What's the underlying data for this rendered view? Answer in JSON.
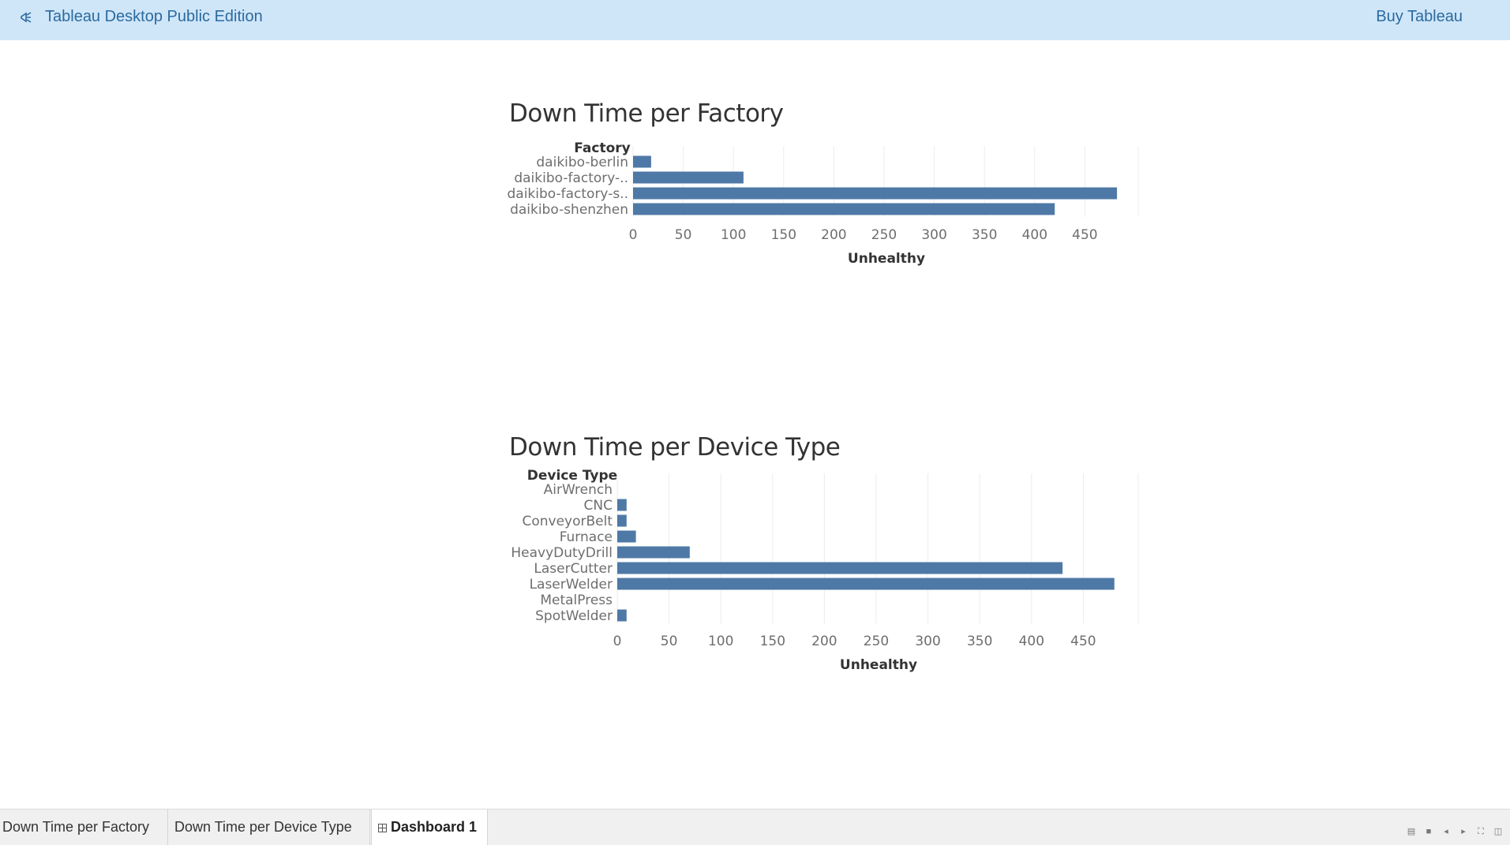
{
  "topbar": {
    "app_title": "Tableau Desktop Public Edition",
    "buy_label": "Buy Tableau",
    "logo_icon": "tableau-logo-icon"
  },
  "colors": {
    "bar": "#4e79a7",
    "topbar": "#cfe6f9",
    "link": "#2b6a9e"
  },
  "chart_data": [
    {
      "type": "bar",
      "orientation": "horizontal",
      "title": "Down Time per Factory",
      "row_header": "Factory",
      "xlabel": "Unhealthy",
      "categories": [
        "daikibo-berlin",
        "daikibo-factory-..",
        "daikibo-factory-s..",
        "daikibo-shenzhen"
      ],
      "values": [
        18,
        110,
        482,
        420
      ],
      "xlim": [
        0,
        500
      ],
      "xticks": [
        0,
        50,
        100,
        150,
        200,
        250,
        300,
        350,
        400,
        450
      ],
      "grid": true
    },
    {
      "type": "bar",
      "orientation": "horizontal",
      "title": "Down Time per Device Type",
      "row_header": "Device Type",
      "xlabel": "Unhealthy",
      "categories": [
        "AirWrench",
        "CNC",
        "ConveyorBelt",
        "Furnace",
        "HeavyDutyDrill",
        "LaserCutter",
        "LaserWelder",
        "MetalPress",
        "SpotWelder"
      ],
      "values": [
        0,
        9,
        9,
        18,
        70,
        430,
        480,
        0,
        9
      ],
      "xlim": [
        0,
        500
      ],
      "xticks": [
        0,
        50,
        100,
        150,
        200,
        250,
        300,
        350,
        400,
        450
      ],
      "grid": true
    }
  ],
  "tabs": [
    {
      "label": "Down Time per Factory",
      "active": false
    },
    {
      "label": "Down Time per Device Type",
      "active": false
    },
    {
      "label": "Dashboard 1",
      "active": true
    }
  ],
  "nav_controls": [
    "gallery-view-icon",
    "single-view-icon",
    "prev-sheet-icon",
    "next-sheet-icon",
    "fullscreen-icon",
    "present-icon"
  ]
}
